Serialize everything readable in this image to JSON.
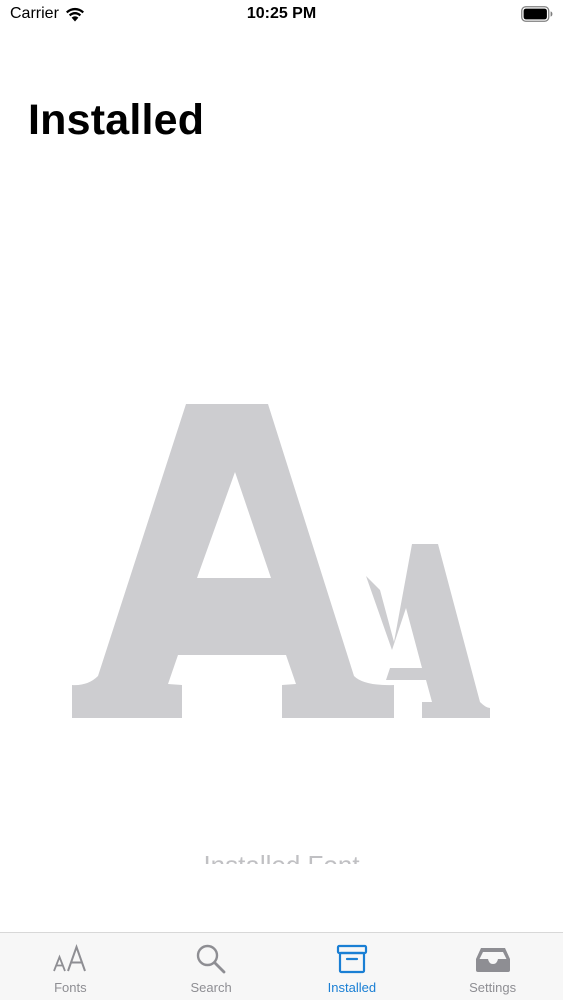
{
  "status_bar": {
    "carrier": "Carrier",
    "time": "10:25 PM"
  },
  "header": {
    "title": "Installed"
  },
  "empty_state": {
    "icon": "font-aa-icon",
    "label": "Installed Font"
  },
  "tab_bar": {
    "active_color": "#1a7fd4",
    "inactive_color": "#8e8e93",
    "tabs": [
      {
        "label": "Fonts",
        "icon": "font-size-icon"
      },
      {
        "label": "Search",
        "icon": "magnifier-icon"
      },
      {
        "label": "Installed",
        "icon": "archive-box-icon",
        "active": true
      },
      {
        "label": "Settings",
        "icon": "tray-icon"
      }
    ]
  }
}
